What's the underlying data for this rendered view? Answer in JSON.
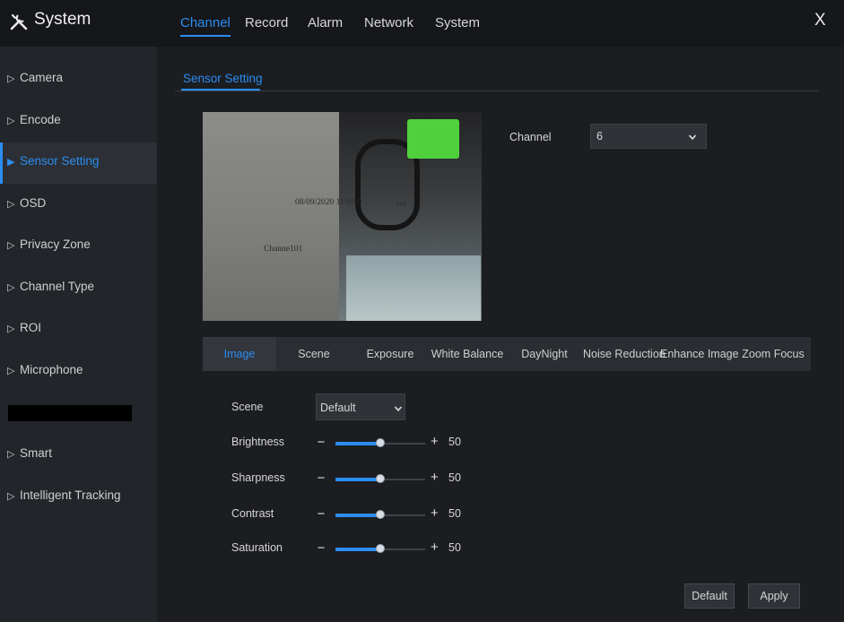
{
  "app": {
    "title": "System",
    "logo_icon": "tools-icon",
    "close_glyph": "X"
  },
  "top_tabs": [
    {
      "label": "Channel",
      "active": true
    },
    {
      "label": "Record",
      "active": false
    },
    {
      "label": "Alarm",
      "active": false
    },
    {
      "label": "Network",
      "active": false
    },
    {
      "label": "System",
      "active": false
    }
  ],
  "sidebar": {
    "items": [
      {
        "label": "Camera",
        "active": false
      },
      {
        "label": "Encode",
        "active": false
      },
      {
        "label": "Sensor Setting",
        "active": true
      },
      {
        "label": "OSD",
        "active": false
      },
      {
        "label": "Privacy Zone",
        "active": false
      },
      {
        "label": "Channel Type",
        "active": false
      },
      {
        "label": "ROI",
        "active": false
      },
      {
        "label": "Microphone",
        "active": false
      },
      {
        "label": "Smart",
        "active": false
      },
      {
        "label": "Intelligent Tracking",
        "active": false
      }
    ]
  },
  "main": {
    "section_tab": "Sensor Setting",
    "preview": {
      "timestamp": "08/09/2020 11:05:0",
      "channel_overlay": "Channe101",
      "overlay_fragment": "res"
    },
    "channel": {
      "label": "Channel",
      "value": "6"
    },
    "subtabs": [
      {
        "label": "Image",
        "active": true
      },
      {
        "label": "Scene",
        "active": false
      },
      {
        "label": "Exposure",
        "active": false
      },
      {
        "label": "White Balance",
        "active": false
      },
      {
        "label": "DayNight",
        "active": false
      },
      {
        "label": "Noise Reduction",
        "active": false
      },
      {
        "label": "Enhance Image",
        "active": false
      },
      {
        "label": "Zoom Focus",
        "active": false
      }
    ],
    "scene": {
      "label": "Scene",
      "value": "Default"
    },
    "sliders": [
      {
        "label": "Brightness",
        "value": "50",
        "fraction": 0.5
      },
      {
        "label": "Sharpness",
        "value": "50",
        "fraction": 0.5
      },
      {
        "label": "Contrast",
        "value": "50",
        "fraction": 0.5
      },
      {
        "label": "Saturation",
        "value": "50",
        "fraction": 0.5
      }
    ],
    "slider_minus": "−",
    "slider_plus": "+",
    "buttons": {
      "default_label": "Default",
      "apply_label": "Apply"
    }
  },
  "colors": {
    "accent": "#2b8df0",
    "background": "#1b1d21",
    "sidebar": "#22252a"
  }
}
